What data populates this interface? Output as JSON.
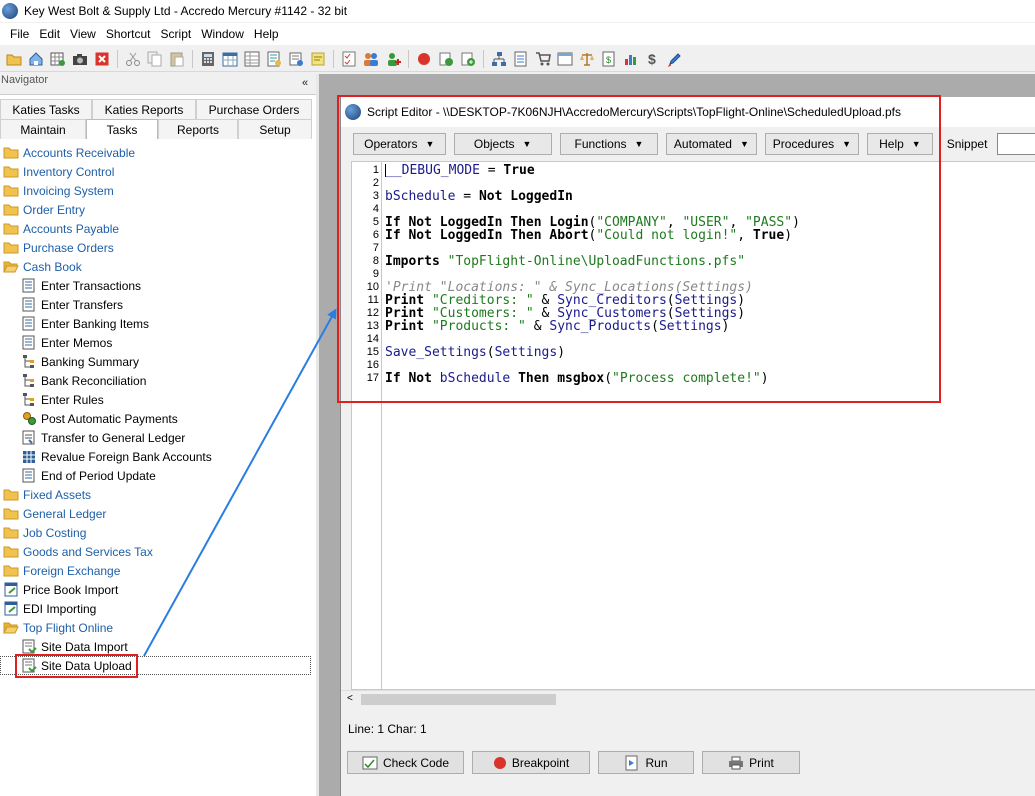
{
  "app": {
    "title": "Key West Bolt & Supply Ltd - Accredo Mercury #1142 - 32 bit"
  },
  "menu": {
    "items": [
      {
        "label": "File"
      },
      {
        "label": "Edit"
      },
      {
        "label": "View"
      },
      {
        "label": "Shortcut"
      },
      {
        "label": "Script"
      },
      {
        "label": "Window"
      },
      {
        "label": "Help"
      }
    ]
  },
  "toolbar": {
    "icons": [
      "open-folder-icon",
      "home-icon",
      "grid-refresh-icon",
      "camera-icon",
      "close-red-icon",
      "scissors-icon",
      "copy-icon",
      "paste-icon",
      "calculator-icon",
      "calendar-grid-icon",
      "table-icon",
      "form-icon",
      "document-icon",
      "note-icon",
      "checklist-icon",
      "people-icon",
      "person-add-icon",
      "stop-icon",
      "refresh-green-icon",
      "add-green-icon",
      "org-chart-icon",
      "report-icon",
      "cart-icon",
      "window-icon",
      "scales-icon",
      "dollar-doc-icon",
      "chart-icon",
      "dollar-icon",
      "rocket-icon"
    ]
  },
  "navigator": {
    "header": "Navigator",
    "close_glyph": "«",
    "tabs_row1": [
      {
        "label": "Katies Tasks"
      },
      {
        "label": "Katies Reports"
      },
      {
        "label": "Purchase Orders"
      }
    ],
    "tabs_row2": [
      {
        "label": "Maintain"
      },
      {
        "label": "Tasks"
      },
      {
        "label": "Reports"
      },
      {
        "label": "Setup"
      }
    ],
    "tree": [
      {
        "label": "Accounts Receivable",
        "level": 0,
        "icon": "folder-icon",
        "link": true
      },
      {
        "label": "Inventory Control",
        "level": 0,
        "icon": "folder-icon",
        "link": true
      },
      {
        "label": "Invoicing System",
        "level": 0,
        "icon": "folder-icon",
        "link": true
      },
      {
        "label": "Order Entry",
        "level": 0,
        "icon": "folder-icon",
        "link": true
      },
      {
        "label": "Accounts Payable",
        "level": 0,
        "icon": "folder-icon",
        "link": true
      },
      {
        "label": "Purchase Orders",
        "level": 0,
        "icon": "folder-icon",
        "link": true
      },
      {
        "label": "Cash Book",
        "level": 0,
        "icon": "folder-open-icon",
        "link": true
      },
      {
        "label": "Enter Transactions",
        "level": 1,
        "icon": "form-icon",
        "link": false
      },
      {
        "label": "Enter Transfers",
        "level": 1,
        "icon": "form-icon",
        "link": false
      },
      {
        "label": "Enter Banking Items",
        "level": 1,
        "icon": "form-icon",
        "link": false
      },
      {
        "label": "Enter Memos",
        "level": 1,
        "icon": "form-icon",
        "link": false
      },
      {
        "label": "Banking Summary",
        "level": 1,
        "icon": "hierarchy-icon",
        "link": false
      },
      {
        "label": "Bank Reconciliation",
        "level": 1,
        "icon": "hierarchy-icon",
        "link": false
      },
      {
        "label": "Enter Rules",
        "level": 1,
        "icon": "hierarchy-icon",
        "link": false
      },
      {
        "label": "Post Automatic Payments",
        "level": 1,
        "icon": "gears-icon",
        "link": false
      },
      {
        "label": "Transfer to General Ledger",
        "level": 1,
        "icon": "transfer-icon",
        "link": false
      },
      {
        "label": "Revalue Foreign Bank Accounts",
        "level": 1,
        "icon": "grid-icon",
        "link": false
      },
      {
        "label": "End of Period Update",
        "level": 1,
        "icon": "form-icon",
        "link": false
      },
      {
        "label": "Fixed Assets",
        "level": 0,
        "icon": "folder-icon",
        "link": true
      },
      {
        "label": "General Ledger",
        "level": 0,
        "icon": "folder-icon",
        "link": true
      },
      {
        "label": "Job Costing",
        "level": 0,
        "icon": "folder-icon",
        "link": true
      },
      {
        "label": "Goods and Services Tax",
        "level": 0,
        "icon": "folder-icon",
        "link": true
      },
      {
        "label": "Foreign Exchange",
        "level": 0,
        "icon": "folder-icon",
        "link": true
      },
      {
        "label": "Price Book Import",
        "level": 0,
        "icon": "script-import-icon",
        "link": false
      },
      {
        "label": "EDI Importing",
        "level": 0,
        "icon": "script-import-icon",
        "link": false
      },
      {
        "label": "Top Flight Online",
        "level": 0,
        "icon": "folder-open-icon",
        "link": true
      },
      {
        "label": "Site Data Import",
        "level": 1,
        "icon": "script-icon",
        "link": false
      },
      {
        "label": "Site Data Upload",
        "level": 1,
        "icon": "script-icon",
        "link": false,
        "selected": true
      }
    ]
  },
  "editor": {
    "title": "Script Editor - \\\\DESKTOP-7K06NJH\\AccredoMercury\\Scripts\\TopFlight-Online\\ScheduledUpload.pfs",
    "menus": [
      {
        "label": "Operators"
      },
      {
        "label": "Objects"
      },
      {
        "label": "Functions"
      },
      {
        "label": "Automated"
      },
      {
        "label": "Procedures"
      },
      {
        "label": "Help"
      }
    ],
    "dropdown_arrow": "▼",
    "snippet_label": "Snippet",
    "code_lines": [
      {
        "n": "1",
        "tokens": [
          {
            "t": "__DEBUG_MODE",
            "c": "id"
          },
          {
            "t": " = ",
            "c": "op"
          },
          {
            "t": "True",
            "c": "kw"
          }
        ]
      },
      {
        "n": "2",
        "tokens": []
      },
      {
        "n": "3",
        "tokens": [
          {
            "t": "bSchedule",
            "c": "id"
          },
          {
            "t": " = ",
            "c": "op"
          },
          {
            "t": "Not",
            "c": "kw"
          },
          {
            "t": " ",
            "c": "op"
          },
          {
            "t": "LoggedIn",
            "c": "kw"
          }
        ]
      },
      {
        "n": "4",
        "tokens": []
      },
      {
        "n": "5",
        "tokens": [
          {
            "t": "If",
            "c": "kw"
          },
          {
            "t": " ",
            "c": "op"
          },
          {
            "t": "Not",
            "c": "kw"
          },
          {
            "t": " ",
            "c": "op"
          },
          {
            "t": "LoggedIn",
            "c": "kw"
          },
          {
            "t": " ",
            "c": "op"
          },
          {
            "t": "Then",
            "c": "kw"
          },
          {
            "t": " ",
            "c": "op"
          },
          {
            "t": "Login",
            "c": "kw"
          },
          {
            "t": "(",
            "c": "op"
          },
          {
            "t": "\"COMPANY\"",
            "c": "str"
          },
          {
            "t": ", ",
            "c": "op"
          },
          {
            "t": "\"USER\"",
            "c": "str"
          },
          {
            "t": ", ",
            "c": "op"
          },
          {
            "t": "\"PASS\"",
            "c": "str"
          },
          {
            "t": ")",
            "c": "op"
          }
        ]
      },
      {
        "n": "6",
        "tokens": [
          {
            "t": "If",
            "c": "kw"
          },
          {
            "t": " ",
            "c": "op"
          },
          {
            "t": "Not",
            "c": "kw"
          },
          {
            "t": " ",
            "c": "op"
          },
          {
            "t": "LoggedIn",
            "c": "kw"
          },
          {
            "t": " ",
            "c": "op"
          },
          {
            "t": "Then",
            "c": "kw"
          },
          {
            "t": " ",
            "c": "op"
          },
          {
            "t": "Abort",
            "c": "kw"
          },
          {
            "t": "(",
            "c": "op"
          },
          {
            "t": "\"Could not login!\"",
            "c": "str"
          },
          {
            "t": ", ",
            "c": "op"
          },
          {
            "t": "True",
            "c": "kw"
          },
          {
            "t": ")",
            "c": "op"
          }
        ]
      },
      {
        "n": "7",
        "tokens": []
      },
      {
        "n": "8",
        "tokens": [
          {
            "t": "Imports",
            "c": "kw"
          },
          {
            "t": " ",
            "c": "op"
          },
          {
            "t": "\"TopFlight-Online\\UploadFunctions.pfs\"",
            "c": "str"
          }
        ]
      },
      {
        "n": "9",
        "tokens": []
      },
      {
        "n": "10",
        "tokens": [
          {
            "t": "'Print \"Locations: \" & Sync_Locations(Settings)",
            "c": "cmt"
          }
        ]
      },
      {
        "n": "11",
        "tokens": [
          {
            "t": "Print",
            "c": "kw"
          },
          {
            "t": " ",
            "c": "op"
          },
          {
            "t": "\"Creditors: \"",
            "c": "str"
          },
          {
            "t": " & ",
            "c": "op"
          },
          {
            "t": "Sync_Creditors",
            "c": "fn"
          },
          {
            "t": "(",
            "c": "op"
          },
          {
            "t": "Settings",
            "c": "fn"
          },
          {
            "t": ")",
            "c": "op"
          }
        ]
      },
      {
        "n": "12",
        "tokens": [
          {
            "t": "Print",
            "c": "kw"
          },
          {
            "t": " ",
            "c": "op"
          },
          {
            "t": "\"Customers: \"",
            "c": "str"
          },
          {
            "t": " & ",
            "c": "op"
          },
          {
            "t": "Sync_Customers",
            "c": "fn"
          },
          {
            "t": "(",
            "c": "op"
          },
          {
            "t": "Settings",
            "c": "fn"
          },
          {
            "t": ")",
            "c": "op"
          }
        ]
      },
      {
        "n": "13",
        "tokens": [
          {
            "t": "Print",
            "c": "kw"
          },
          {
            "t": " ",
            "c": "op"
          },
          {
            "t": "\"Products: \"",
            "c": "str"
          },
          {
            "t": " & ",
            "c": "op"
          },
          {
            "t": "Sync_Products",
            "c": "fn"
          },
          {
            "t": "(",
            "c": "op"
          },
          {
            "t": "Settings",
            "c": "fn"
          },
          {
            "t": ")",
            "c": "op"
          }
        ]
      },
      {
        "n": "14",
        "tokens": []
      },
      {
        "n": "15",
        "tokens": [
          {
            "t": "Save_Settings",
            "c": "fn"
          },
          {
            "t": "(",
            "c": "op"
          },
          {
            "t": "Settings",
            "c": "fn"
          },
          {
            "t": ")",
            "c": "op"
          }
        ]
      },
      {
        "n": "16",
        "tokens": []
      },
      {
        "n": "17",
        "tokens": [
          {
            "t": "If",
            "c": "kw"
          },
          {
            "t": " ",
            "c": "op"
          },
          {
            "t": "Not",
            "c": "kw"
          },
          {
            "t": " ",
            "c": "op"
          },
          {
            "t": "bSchedule",
            "c": "id"
          },
          {
            "t": " ",
            "c": "op"
          },
          {
            "t": "Then",
            "c": "kw"
          },
          {
            "t": " ",
            "c": "op"
          },
          {
            "t": "msgbox",
            "c": "kw"
          },
          {
            "t": "(",
            "c": "op"
          },
          {
            "t": "\"Process complete!\"",
            "c": "str"
          },
          {
            "t": ")",
            "c": "op"
          }
        ]
      }
    ],
    "status": "Line: 1  Char: 1",
    "scroll_left_glyph": "<",
    "buttons": [
      {
        "label": "Check Code",
        "icon": "check-code-icon"
      },
      {
        "label": "Breakpoint",
        "icon": "breakpoint-icon"
      },
      {
        "label": "Run",
        "icon": "run-icon"
      },
      {
        "label": "Print",
        "icon": "printer-icon"
      }
    ]
  },
  "colors": {
    "link": "#1e5fa8",
    "highlight_red": "#e02020",
    "arrow_blue": "#2a7de1",
    "code_identifier": "#1a1a8c",
    "code_string": "#1e7a1e",
    "code_comment": "#888888"
  }
}
